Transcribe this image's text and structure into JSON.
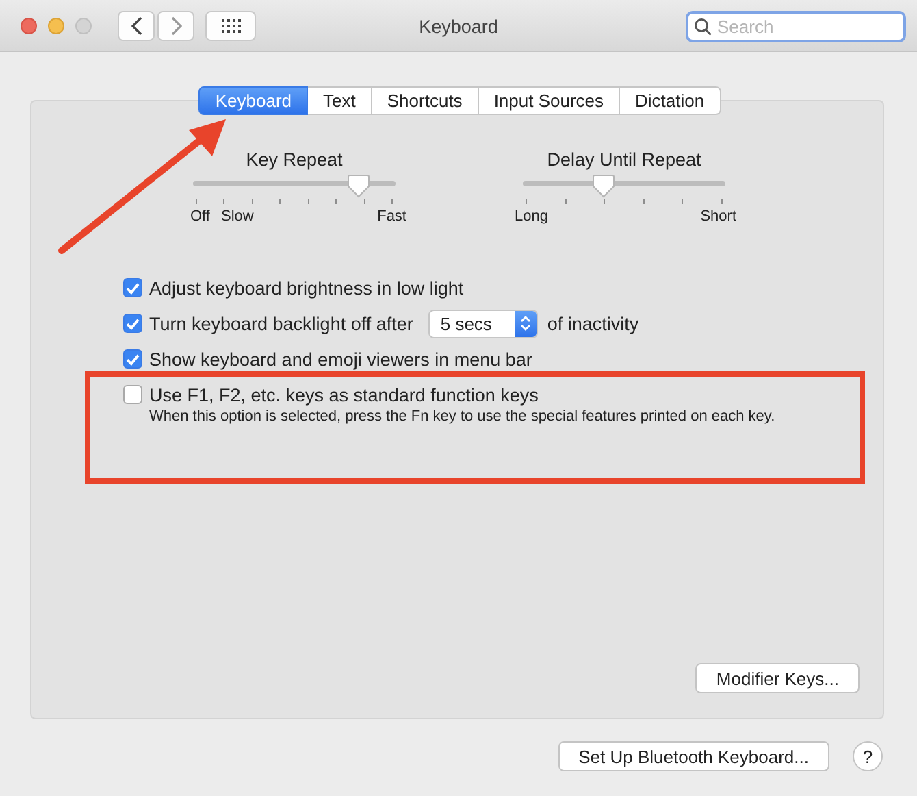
{
  "window": {
    "title": "Keyboard",
    "search": {
      "placeholder": "Search"
    }
  },
  "tabs": [
    {
      "label": "Keyboard",
      "selected": true
    },
    {
      "label": "Text",
      "selected": false
    },
    {
      "label": "Shortcuts",
      "selected": false
    },
    {
      "label": "Input Sources",
      "selected": false
    },
    {
      "label": "Dictation",
      "selected": false
    }
  ],
  "sliders": [
    {
      "kind": "key-repeat",
      "title": "Key Repeat",
      "level": 0.82,
      "labels": [
        "Off",
        "Slow",
        "Fast"
      ]
    },
    {
      "kind": "delay",
      "title": "Delay Until Repeat",
      "level": 0.4,
      "labels": [
        "Long",
        "Short"
      ]
    }
  ],
  "options": [
    {
      "kind": "plain",
      "label": "Adjust keyboard brightness in low light",
      "checked": true
    },
    {
      "kind": "popup",
      "label": "Turn keyboard backlight off after",
      "checked": true,
      "popup": "5 secs",
      "suffix": "of inactivity"
    },
    {
      "kind": "plain",
      "label": "Show keyboard and emoji viewers in menu bar",
      "checked": true
    },
    {
      "kind": "described",
      "label": "Use F1, F2, etc. keys as standard function keys",
      "checked": false,
      "description": "When this option is selected, press the Fn key to use the special features printed on each key."
    }
  ],
  "modifier_button": "Modifier Keys...",
  "footer": {
    "bluetooth_button": "Set Up Bluetooth Keyboard...",
    "help_button": "?"
  },
  "annotations": [
    {
      "kind": "arrow"
    },
    {
      "kind": "highlight-box"
    }
  ]
}
